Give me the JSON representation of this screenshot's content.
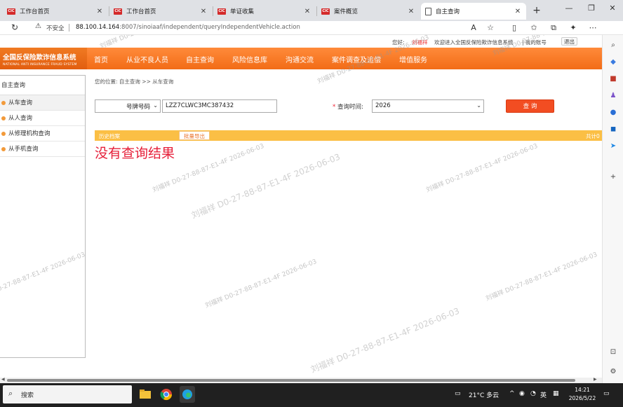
{
  "browser": {
    "tabs": [
      {
        "title": "工作台首页",
        "icon": "picc-logo-icon",
        "active": false
      },
      {
        "title": "工作台首页",
        "icon": "picc-logo-icon",
        "active": false
      },
      {
        "title": "单证收集",
        "icon": "picc-logo-icon",
        "active": false
      },
      {
        "title": "案件概览",
        "icon": "picc-logo-icon",
        "active": false
      },
      {
        "title": "自主查询",
        "icon": "page-icon",
        "active": true
      }
    ],
    "tab_icon_text": "CIC",
    "new_tab": "+",
    "address": {
      "security_label": "不安全",
      "url_host": "88.100.14.164",
      "url_rest": ":8007/sinoiaaf/independent/queryIndependentVehicle.action"
    },
    "window_controls": [
      "—",
      "❐",
      "✕"
    ]
  },
  "page": {
    "top_info": {
      "greeting": "您好:",
      "username": "刘福祥",
      "welcome": "欢迎进入全国反保险欺诈信息系统",
      "my_account": "| 我的账号",
      "logout": "退出"
    },
    "logo": {
      "cn": "全国反保险欺诈信息系统",
      "en": "NATIONAL ANTI INSURANCE FRAUD SYSTEM"
    },
    "nav": [
      "首页",
      "从业不良人员",
      "自主查询",
      "风险信息库",
      "沟通交流",
      "案件调查及追偿",
      "增值服务"
    ],
    "sidebar": {
      "title": "自主查询",
      "items": [
        "从车查询",
        "从人查询",
        "从修理机构查询",
        "从手机查询"
      ]
    },
    "breadcrumb": "您的位置: 自主查询 >> 从车查询",
    "search": {
      "type_selected": "号牌号码",
      "plate_value": "LZZ7CLWC3MC387432",
      "time_required": "*",
      "time_label": "查询时间:",
      "year_selected": "2026",
      "query_button": "查 询"
    },
    "results": {
      "history_label": "历史档案",
      "export_button": "批量导出",
      "total_label": "共计0",
      "empty_message": "没有查询结果"
    },
    "watermark": "刘福祥 D0-27-88-87-E1-4F 2026-06-03"
  },
  "taskbar": {
    "search_placeholder": "搜索",
    "weather": "21°C 多云",
    "ime": "英",
    "time": "14:21",
    "date": "2026/5/22"
  },
  "colors": {
    "nav_orange": "#f26c16",
    "query_red": "#f24d22",
    "result_bar": "#fbbf45",
    "empty_red": "#e6203a"
  }
}
